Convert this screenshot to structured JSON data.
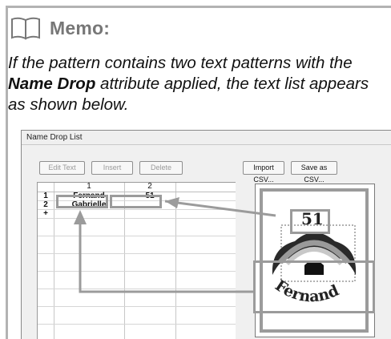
{
  "memo": {
    "title": "Memo:",
    "text_before": "If the pattern contains two text patterns with the ",
    "text_bold": "Name Drop",
    "text_after": " attribute applied, the text list appears as shown below."
  },
  "dialog": {
    "title": "Name Drop List",
    "buttons": {
      "edit_text": "Edit Text",
      "insert": "Insert",
      "delete": "Delete",
      "import_csv": "Import CSV...",
      "save_csv": "Save as CSV..."
    },
    "grid": {
      "columns": [
        "1",
        "2"
      ],
      "rows": [
        {
          "num": "1",
          "col1": "Fernand",
          "col2": "51"
        },
        {
          "num": "2",
          "col1": "Gabrielle",
          "col2": ""
        },
        {
          "num": "+",
          "col1": "",
          "col2": ""
        }
      ]
    },
    "preview": {
      "number_text": "51",
      "name_text": "Fernand"
    }
  },
  "colors": {
    "callout_gray": "#9b9b9b",
    "memo_title": "#777777"
  }
}
